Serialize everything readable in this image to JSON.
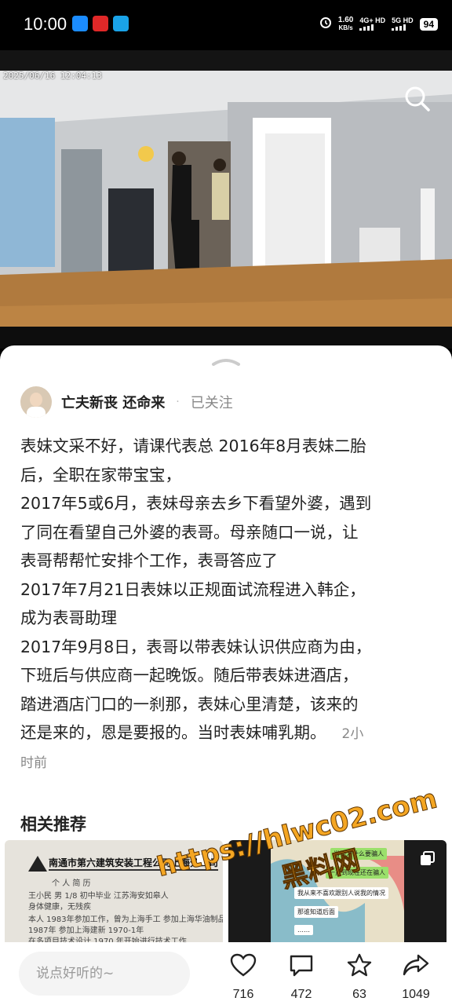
{
  "status_bar": {
    "time": "10:00",
    "speed_value": "1.60",
    "speed_unit": "KB/s",
    "net1": "4G+ HD",
    "net2": "5G HD",
    "battery": "94"
  },
  "video": {
    "timestamp": "2025/06/16 12:04:13"
  },
  "author": {
    "name": "亡夫新丧 还命来",
    "separator": "·",
    "follow_state": "已关注"
  },
  "post": {
    "lines": [
      "表妹文采不好，请课代表总 2016年8月表妹二胎",
      "后，全职在家带宝宝，",
      "2017年5或6月，表妹母亲去乡下看望外婆，遇到",
      "了同在看望自己外婆的表哥。母亲随口一说，让",
      "表哥帮帮忙安排个工作，表哥答应了",
      "2017年7月21日表妹以正规面试流程进入韩企，",
      "成为表哥助理",
      "2017年9月8日，表哥以带表妹认识供应商为由，",
      "下班后与供应商一起晚饭。随后带表妹进酒店，",
      "踏进酒店门口的一刹那，表妹心里清楚，该来的",
      "还是来的，恩是要报的。当时表妹哺乳期。"
    ],
    "time_part1": "2小",
    "time_part2": "时前"
  },
  "related": {
    "title": "相关推荐",
    "thumb1": {
      "heading": "南通市第六建筑安装工程公司上海分公司",
      "lines": [
        "个 人 简 历",
        "王小民   男   1/8   初中毕业   江苏海安如皋人",
        "身体健康，无残疾",
        "本人 1983年参加工作，曾为上海手工 参加上海华油制品厂",
        "1987年 参加上海建新 1970-1年",
        "在多项目技术设计 1970 年开始进行技术工作"
      ]
    },
    "thumb2": {
      "bubbles": [
        "当初为什么要骗人",
        "一直到现在还在骗人",
        "我从来不喜欢跟别人说我的情况",
        "那谁知道后面",
        "……"
      ]
    }
  },
  "watermark": {
    "url": "https://hlwc02.com",
    "text": "黑料网"
  },
  "bottom_bar": {
    "comment_placeholder": "说点好听的~",
    "likes": "716",
    "comments": "472",
    "favorites": "63",
    "shares": "1049"
  },
  "colors": {
    "watermark": "#f4a623",
    "text": "#222222",
    "muted": "#888888"
  }
}
